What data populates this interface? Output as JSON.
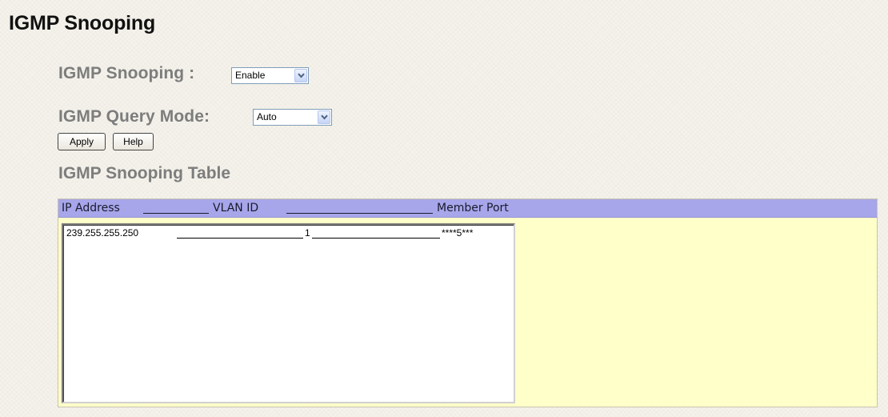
{
  "page": {
    "title": "IGMP Snooping"
  },
  "igmp_snooping": {
    "label": "IGMP Snooping :",
    "selected": "Enable"
  },
  "query_mode": {
    "label": "IGMP Query Mode:",
    "selected": "Auto"
  },
  "buttons": {
    "apply": "Apply",
    "help": "Help"
  },
  "table": {
    "heading": "IGMP Snooping Table",
    "columns": [
      "IP Address",
      "VLAN ID",
      "Member Port"
    ],
    "rows": [
      {
        "ip_address": "239.255.255.250",
        "vlan_id": "1",
        "member_port": "****5***"
      }
    ]
  },
  "colors": {
    "header_bg": "#a7a6ea",
    "panel_bg": "#ffffc9",
    "label_gray": "#7d7d7d"
  },
  "icons": {
    "dropdown": "chevron-down-icon"
  }
}
